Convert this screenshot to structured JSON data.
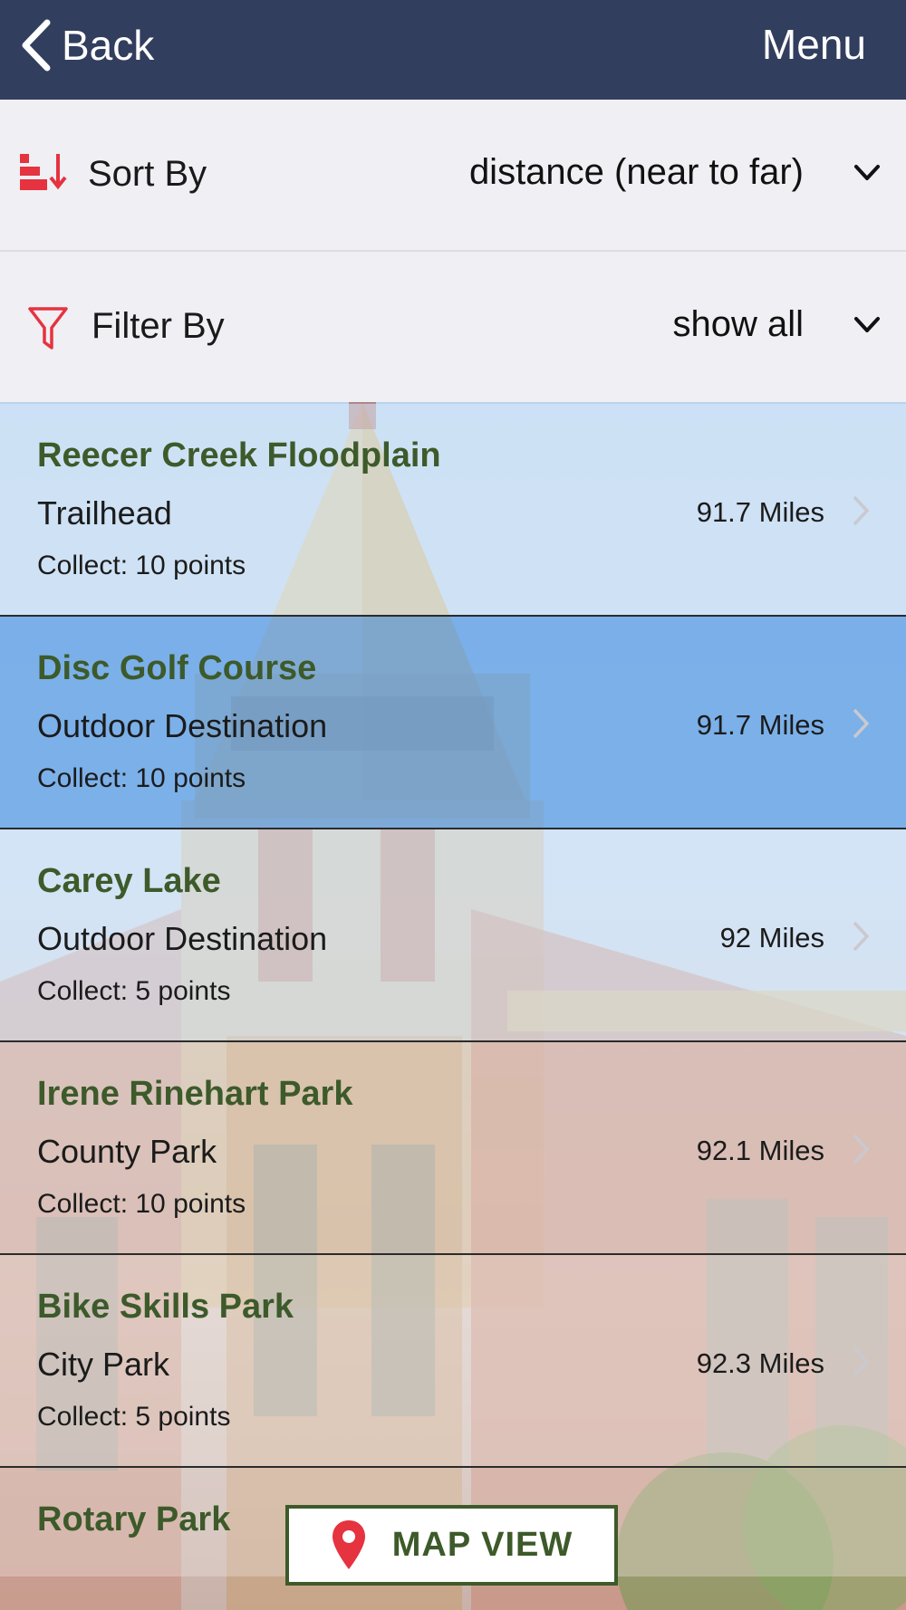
{
  "nav": {
    "back_label": "Back",
    "menu_label": "Menu"
  },
  "sort": {
    "label": "Sort By",
    "value": "distance (near to far)"
  },
  "filter": {
    "label": "Filter By",
    "value": "show all"
  },
  "places": [
    {
      "name": "Reecer Creek Floodplain",
      "type": "Trailhead",
      "distance": "91.7 Miles",
      "points": "Collect: 10 points"
    },
    {
      "name": "Disc Golf Course",
      "type": "Outdoor Destination",
      "distance": "91.7 Miles",
      "points": "Collect: 10 points"
    },
    {
      "name": "Carey Lake",
      "type": "Outdoor Destination",
      "distance": "92 Miles",
      "points": "Collect: 5 points"
    },
    {
      "name": "Irene Rinehart Park",
      "type": "County Park",
      "distance": "92.1 Miles",
      "points": "Collect: 10 points"
    },
    {
      "name": "Bike Skills Park",
      "type": "City Park",
      "distance": "92.3 Miles",
      "points": "Collect: 5 points"
    },
    {
      "name": "Rotary Park"
    }
  ],
  "map_button": {
    "label": "MAP VIEW"
  },
  "colors": {
    "navbar": "#323e5e",
    "title_green": "#3d5a2a",
    "accent_red": "#e5333f",
    "selected_row": "#5fa0e6"
  }
}
